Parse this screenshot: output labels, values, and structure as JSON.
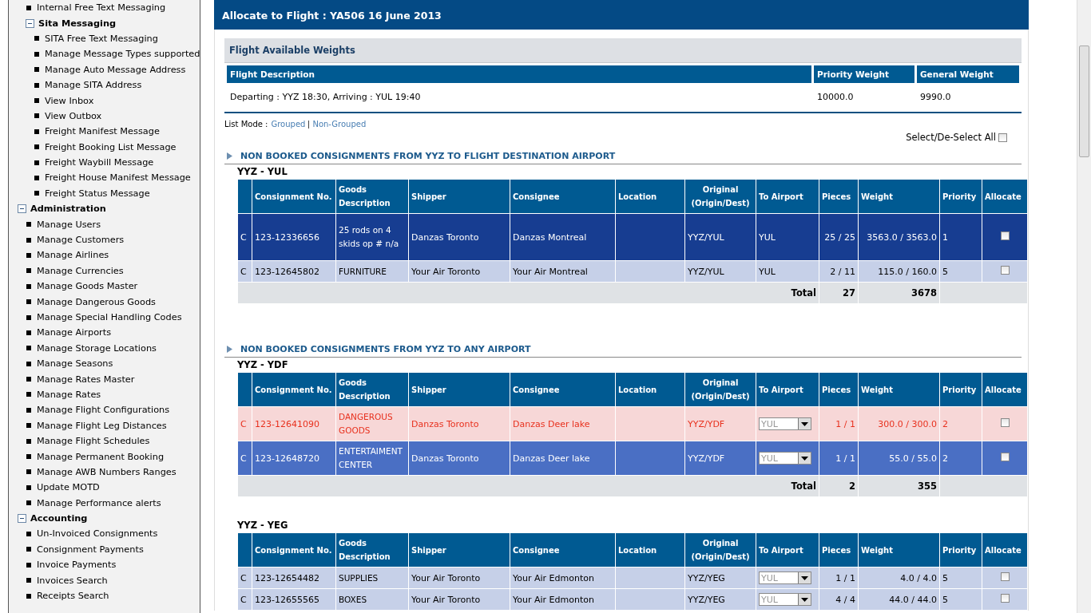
{
  "sidebar": {
    "items": [
      {
        "children": [
          {
            "label": "Internal Free Text Messaging"
          },
          {
            "label": "Sita Messaging",
            "expanded": true,
            "children": [
              {
                "label": "SITA Free Text Messaging"
              },
              {
                "label": "Manage Message Types supported"
              },
              {
                "label": "Manage Auto Message Address"
              },
              {
                "label": "Manage SITA Address"
              },
              {
                "label": "View Inbox"
              },
              {
                "label": "View Outbox"
              },
              {
                "label": "Freight Manifest Message"
              },
              {
                "label": "Freight Booking List Message"
              },
              {
                "label": "Freight Waybill Message"
              },
              {
                "label": "Freight House Manifest Message"
              },
              {
                "label": "Freight Status Message"
              }
            ]
          }
        ]
      },
      {
        "label": "Administration",
        "expanded": true,
        "children": [
          {
            "label": "Manage Users"
          },
          {
            "label": "Manage Customers"
          },
          {
            "label": "Manage Airlines"
          },
          {
            "label": "Manage Currencies"
          },
          {
            "label": "Manage Goods Master"
          },
          {
            "label": "Manage Dangerous Goods"
          },
          {
            "label": "Manage Special Handling Codes"
          },
          {
            "label": "Manage Airports"
          },
          {
            "label": "Manage Storage Locations"
          },
          {
            "label": "Manage Seasons"
          },
          {
            "label": "Manage Rates Master"
          },
          {
            "label": "Manage Rates"
          },
          {
            "label": "Manage Flight Configurations"
          },
          {
            "label": "Manage Flight Leg Distances"
          },
          {
            "label": "Manage Flight Schedules"
          },
          {
            "label": "Manage Permanent Booking"
          },
          {
            "label": "Manage AWB Numbers Ranges"
          },
          {
            "label": "Update MOTD"
          },
          {
            "label": "Manage Performance alerts"
          }
        ]
      },
      {
        "label": "Accounting",
        "expanded": true,
        "children": [
          {
            "label": "Un-Invoiced Consignments"
          },
          {
            "label": "Consignment Payments"
          },
          {
            "label": "Invoice Payments"
          },
          {
            "label": "Invoices Search"
          },
          {
            "label": "Receipts Search"
          }
        ]
      }
    ]
  },
  "page_title": "Allocate to Flight : YA506 16 June 2013",
  "weights": {
    "title": "Flight Available Weights",
    "columns": [
      "Flight Description",
      "Priority Weight",
      "General Weight"
    ],
    "row": [
      "Departing : YYZ 18:30, Arriving : YUL 19:40",
      "10000.0",
      "9990.0"
    ]
  },
  "list_mode": {
    "label": "List Mode :",
    "options": [
      {
        "label": "Grouped"
      },
      {
        "label": "Non-Grouped"
      }
    ]
  },
  "select_all": {
    "label": "Select/De-Select All",
    "checked": false
  },
  "sections": [
    {
      "title": "NON BOOKED CONSIGNMENTS FROM YYZ TO FLIGHT DESTINATION AIRPORT",
      "groups": [
        {
          "route": "YYZ - YUL",
          "airport_select": false,
          "columns": [
            "",
            "Consignment No.",
            "Goods Description",
            "Shipper",
            "Consignee",
            "Location",
            "Original (Origin/Dest)",
            "To Airport",
            "Pieces",
            "Weight",
            "Priority",
            "Allocate"
          ],
          "rows": [
            {
              "kind": "highlight",
              "cells": [
                "C",
                "123-12336656",
                "25 rods on 4 skids op # n/a",
                "Danzas Toronto",
                "Danzas Montreal",
                "",
                "YYZ/YUL",
                "YUL",
                "25 / 25",
                "3563.0 / 3563.0",
                "1"
              ],
              "allocate": false
            },
            {
              "kind": "normal",
              "cells": [
                "C",
                "123-12645802",
                "FURNITURE",
                "Your Air Toronto",
                "Your Air Montreal",
                "",
                "YYZ/YUL",
                "YUL",
                "2 / 11",
                "115.0 / 160.0",
                "5"
              ],
              "allocate": false
            }
          ],
          "total": {
            "label": "Total",
            "pieces": "27",
            "weight": "3678"
          }
        }
      ]
    },
    {
      "title": "NON BOOKED CONSIGNMENTS FROM YYZ TO ANY AIRPORT",
      "groups": [
        {
          "route": "YYZ - YDF",
          "airport_select": true,
          "columns": [
            "",
            "Consignment No.",
            "Goods Description",
            "Shipper",
            "Consignee",
            "Location",
            "Original (Origin/Dest)",
            "To Airport",
            "Pieces",
            "Weight",
            "Priority",
            "Allocate"
          ],
          "rows": [
            {
              "kind": "danger",
              "cells": [
                "C",
                "123-12641090",
                "DANGEROUS GOODS",
                "Danzas Toronto",
                "Danzas Deer lake",
                "",
                "YYZ/YDF",
                "YUL",
                "1 / 1",
                "300.0 / 300.0",
                "2"
              ],
              "allocate": false
            },
            {
              "kind": "selected",
              "cells": [
                "C",
                "123-12648720",
                "ENTERTAIMENT CENTER",
                "Danzas Toronto",
                "Danzas Deer lake",
                "",
                "YYZ/YDF",
                "YUL",
                "1 / 1",
                "55.0 / 55.0",
                "2"
              ],
              "allocate": false
            }
          ],
          "total": {
            "label": "Total",
            "pieces": "2",
            "weight": "355"
          }
        },
        {
          "route": "YYZ - YEG",
          "airport_select": true,
          "columns": [
            "",
            "Consignment No.",
            "Goods Description",
            "Shipper",
            "Consignee",
            "Location",
            "Original (Origin/Dest)",
            "To Airport",
            "Pieces",
            "Weight",
            "Priority",
            "Allocate"
          ],
          "rows": [
            {
              "kind": "normal",
              "cells": [
                "C",
                "123-12654482",
                "SUPPLIES",
                "Your Air Toronto",
                "Your Air Edmonton",
                "",
                "YYZ/YEG",
                "YUL",
                "1 / 1",
                "4.0 / 4.0",
                "5"
              ],
              "allocate": false
            },
            {
              "kind": "normal",
              "cells": [
                "C",
                "123-12655565",
                "BOXES",
                "Your Air Toronto",
                "Your Air Edmonton",
                "",
                "YYZ/YEG",
                "YUL",
                "4 / 4",
                "44.0 / 44.0",
                "5"
              ],
              "allocate": false
            }
          ]
        }
      ]
    }
  ]
}
